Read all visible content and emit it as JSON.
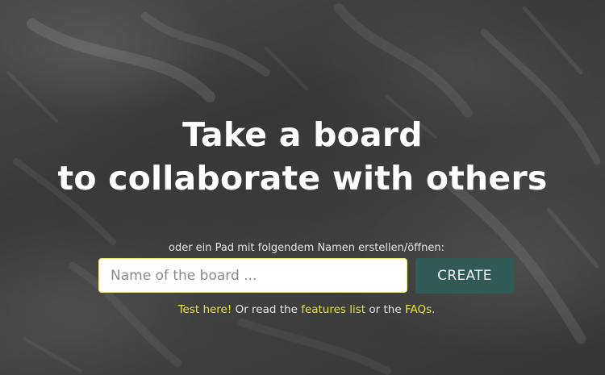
{
  "hero": {
    "line1": "Take a board",
    "line2": "to collaborate with others"
  },
  "form": {
    "subtitle": "oder ein Pad mit folgendem Namen erstellen/öffnen:",
    "input_placeholder": "Name of the board ...",
    "input_value": "",
    "create_label": "CREATE"
  },
  "links": {
    "test_here": "Test here!",
    "text_1": " Or read the ",
    "features_list": "features list",
    "text_2": " or the ",
    "faqs": "FAQs."
  },
  "colors": {
    "link": "#e7e23a",
    "button_bg": "#2f5a56",
    "input_border": "#e8e87a",
    "background": "#3d3d3d"
  }
}
